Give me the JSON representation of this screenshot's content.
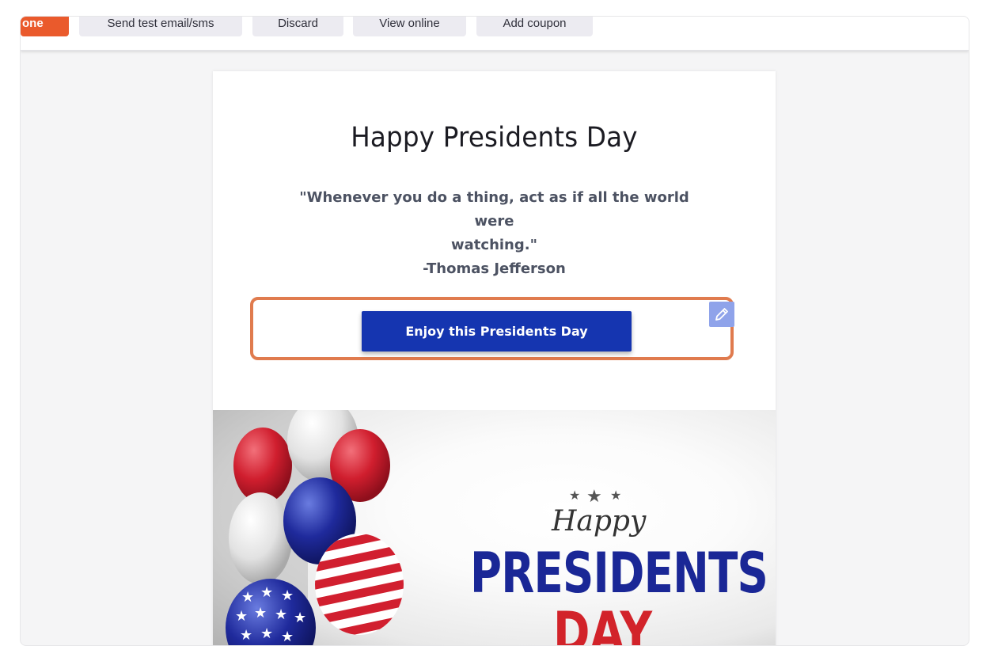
{
  "toolbar": {
    "buttons": [
      {
        "label": "one"
      },
      {
        "label": "Send test email/sms"
      },
      {
        "label": "Discard"
      },
      {
        "label": "View online"
      },
      {
        "label": "Add coupon"
      }
    ]
  },
  "email": {
    "title": "Happy Presidents Day",
    "quote_line1": "\"Whenever you do a thing, act as if all the world were",
    "quote_line2": "watching.\"",
    "quote_author": "-Thomas Jefferson",
    "cta_label": "Enjoy this Presidents Day",
    "edit_icon": "pencil-icon",
    "banner": {
      "happy": "Happy",
      "presidents": "PRESIDENTS",
      "day": "DAY"
    }
  },
  "colors": {
    "accent_orange": "#ea5a2c",
    "cta_blue": "#1535b0",
    "selection_border": "#e07b4e",
    "edit_button": "#8fa3ea"
  }
}
